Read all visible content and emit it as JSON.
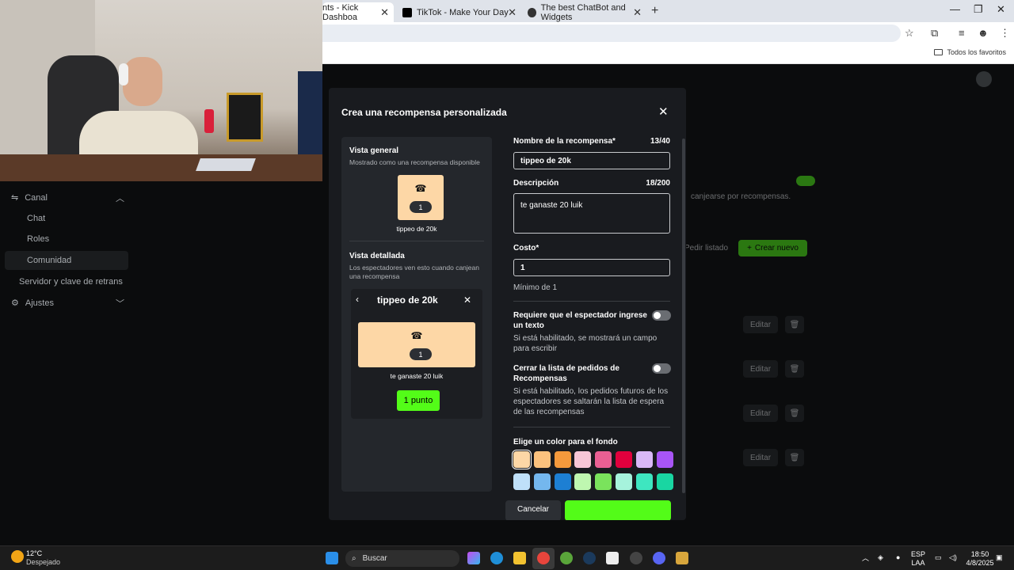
{
  "browser": {
    "tabs": [
      {
        "label": "nts - Kick Dashboa"
      },
      {
        "label": "TikTok - Make Your Day"
      },
      {
        "label": "The best ChatBot and Widgets"
      }
    ],
    "bookmarks_label": "Todos los favoritos"
  },
  "sidebar": {
    "canal": "Canal",
    "items": [
      "Chat",
      "Roles",
      "Comunidad"
    ],
    "servidor": "Servidor y clave de retrans",
    "ajustes": "Ajustes"
  },
  "background": {
    "text1": "canjearse por recompensas.",
    "pedir": "Pedir listado",
    "crear": "Crear nuevo",
    "edit_label": "Editar"
  },
  "modal": {
    "title": "Crea una recompensa personalizada",
    "preview": {
      "general_title": "Vista general",
      "general_sub": "Mostrado como una recompensa disponible",
      "count": "1",
      "reward_name": "tippeo de 20k",
      "detail_title": "Vista detallada",
      "detail_sub": "Los espectadores ven esto cuando canjean una recompensa",
      "detail_name": "tippeo de 20k",
      "detail_desc": "te ganaste 20 luik",
      "point_button": "1 punto"
    },
    "form": {
      "name_label": "Nombre de la recompensa*",
      "name_count": "13/40",
      "name_value": "tippeo de 20k",
      "desc_label": "Descripción",
      "desc_count": "18/200",
      "desc_value": "te ganaste 20 luik",
      "cost_label": "Costo*",
      "cost_value": "1",
      "cost_hint": "Mínimo de 1",
      "require_title": "Requiere que el espectador ingrese un texto",
      "require_desc": "Si está habilitado, se mostrará un campo para escribir",
      "close_title": "Cerrar la lista de pedidos de Recompensas",
      "close_desc": "Si está habilitado, los pedidos futuros de los espectadores se saltarán la lista de espera de las recompensas",
      "color_label": "Elige un color para el fondo",
      "colors_row1": [
        "#fdd7a6",
        "#fbc27e",
        "#f59a3c",
        "#f7c6d6",
        "#ea5f93",
        "#e1003d",
        "#d9b8f7",
        "#a855f7"
      ],
      "colors_row2": [
        "#bfe0f9",
        "#74b7ee",
        "#1d7fd3",
        "#bff7b0",
        "#7ae35c",
        "#a6f3dc",
        "#3ee6c0",
        "#19d6a2"
      ],
      "cancel": "Cancelar"
    }
  },
  "taskbar": {
    "weather_temp": "12°C",
    "weather_desc": "Despejado",
    "search_placeholder": "Buscar",
    "lang1": "ESP",
    "lang2": "LAA",
    "time": "18:50",
    "date": "4/8/2025"
  }
}
